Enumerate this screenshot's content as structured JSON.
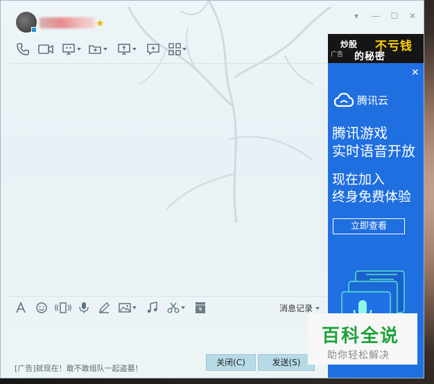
{
  "titlebar": {
    "window_controls": [
      {
        "name": "dropdown-icon",
        "glyph": "▾"
      },
      {
        "name": "minimize-icon",
        "glyph": "—"
      },
      {
        "name": "maximize-icon",
        "glyph": "☐"
      },
      {
        "name": "close-icon",
        "glyph": "✕"
      }
    ]
  },
  "toolbar": {
    "icons": [
      "phone-icon",
      "video-call-icon",
      "remote-desktop-icon",
      "share-screen-icon",
      "screen-share-icon",
      "chat-bubble-icon",
      "app-grid-icon"
    ]
  },
  "input_toolbar": {
    "icons": [
      "font-icon",
      "emoji-icon",
      "shake-icon",
      "voice-icon",
      "pen-icon",
      "image-icon",
      "music-icon",
      "scissors-icon",
      "red-packet-icon"
    ],
    "history_label": "消息记录"
  },
  "footer": {
    "ad_text": "[广告]就现在！敢不敢组队一起盗墓！",
    "close_button": "关闭(C)",
    "send_button": "发送(S)"
  },
  "side_ad": {
    "top_banner": {
      "prefix": "炒股",
      "highlight": "不亏钱",
      "sub": "的秘密",
      "ad_tag": "广告"
    },
    "brand": "腾讯云",
    "headline": [
      "腾讯游戏",
      "实时语音开放"
    ],
    "subline": [
      "现在加入",
      "终身免费体验"
    ],
    "cta": "立即查看"
  },
  "watermark": {
    "main": "百科全说",
    "sub": "助你轻松解决"
  },
  "colors": {
    "ad_blue": "#1f6fe0",
    "button_bg": "#b7dbe6",
    "watermark_green": "#1da23b"
  }
}
